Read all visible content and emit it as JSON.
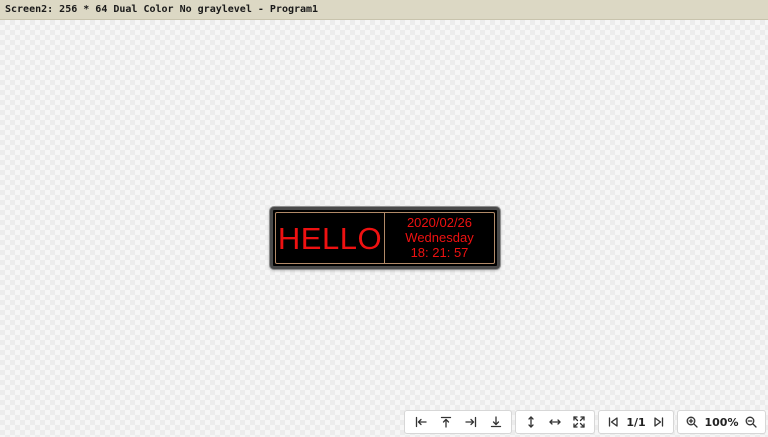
{
  "window": {
    "title": "Screen2: 256 * 64 Dual Color No graylevel - Program1"
  },
  "led_display": {
    "left_text": "HELLO",
    "date": "2020/02/26",
    "weekday": "Wednesday",
    "time": "18: 21: 57",
    "text_color": "#ee1111",
    "background_color": "#000000",
    "divider_color": "#b28a68"
  },
  "toolbar": {
    "icons": {
      "align_left": "align-left-icon",
      "align_top": "align-top-icon",
      "align_right": "align-right-icon",
      "align_bottom": "align-bottom-icon",
      "stretch_vertical": "stretch-vertical-icon",
      "stretch_horizontal": "stretch-horizontal-icon",
      "fit": "fit-screen-icon",
      "prev_page": "previous-page-icon",
      "next_page": "next-page-icon",
      "zoom_in": "zoom-in-icon",
      "zoom_out": "zoom-out-icon"
    },
    "page_indicator": "1/1",
    "zoom_level": "100%"
  }
}
